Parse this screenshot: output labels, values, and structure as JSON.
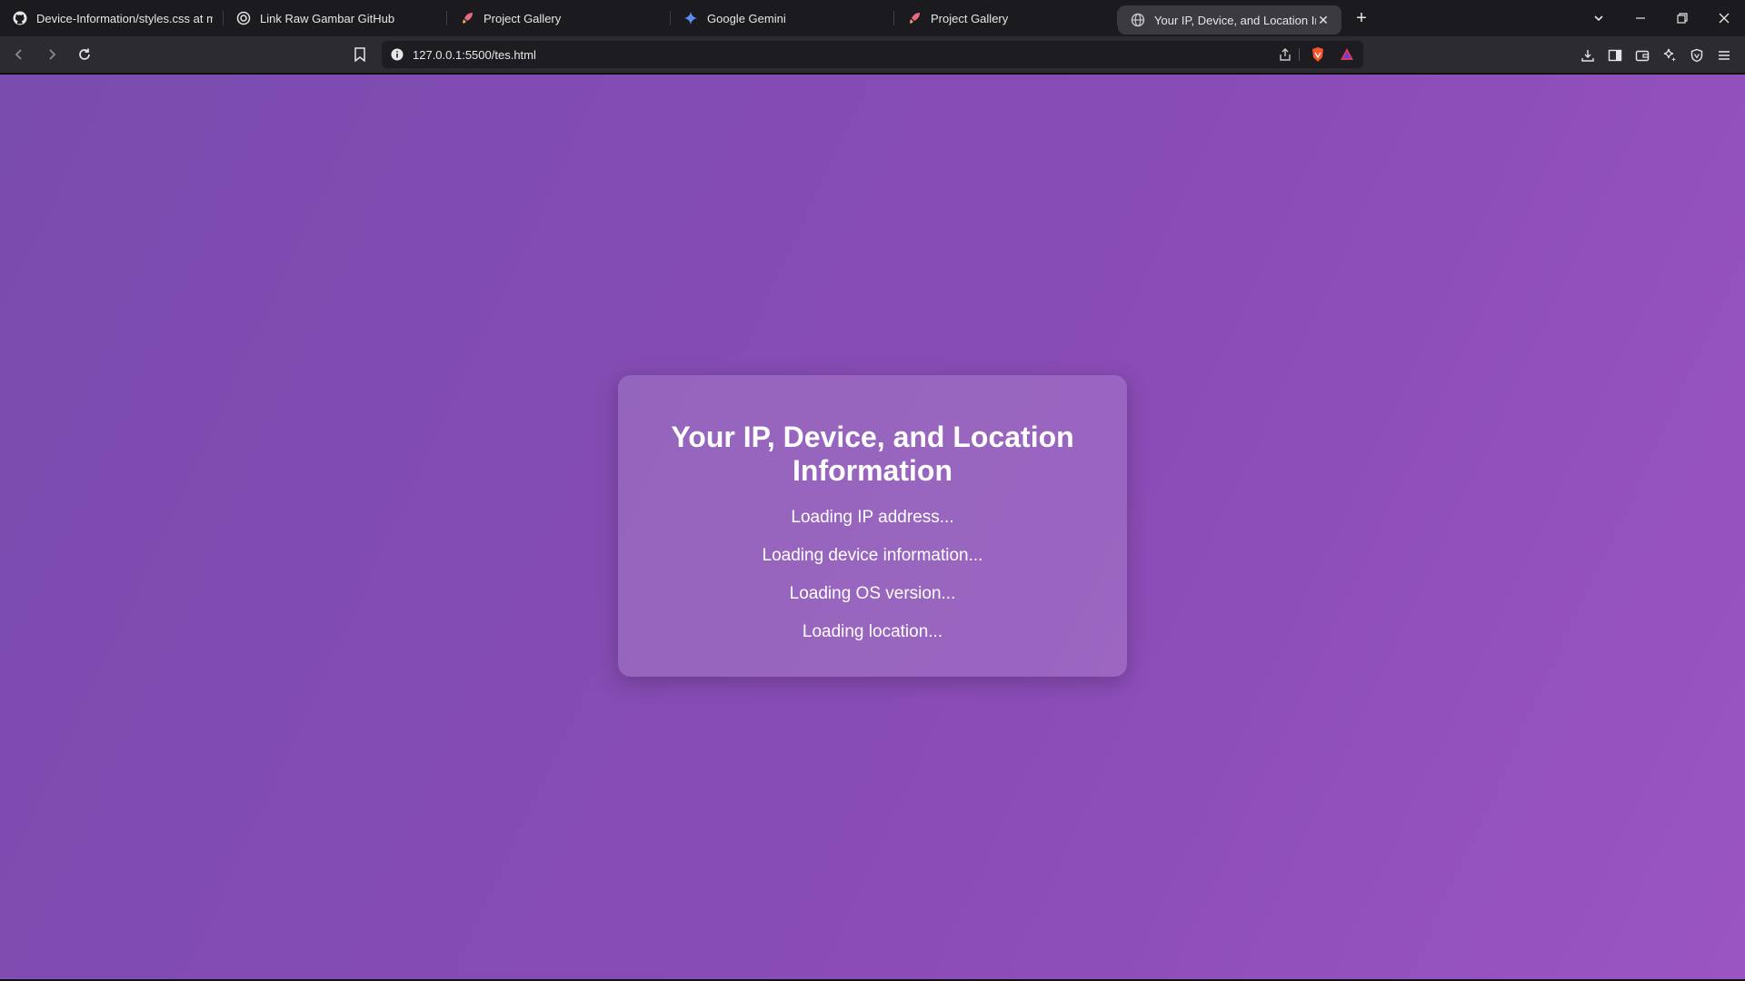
{
  "tabs": [
    {
      "label": "Device-Information/styles.css at main",
      "icon": "github-icon"
    },
    {
      "label": "Link Raw Gambar GitHub",
      "icon": "openai-icon"
    },
    {
      "label": "Project Gallery",
      "icon": "rocket-icon"
    },
    {
      "label": "Google Gemini",
      "icon": "gemini-icon"
    },
    {
      "label": "Project Gallery",
      "icon": "rocket-icon"
    },
    {
      "label": "Your IP, Device, and Location Information",
      "icon": "globe-icon",
      "active": true
    }
  ],
  "address_bar": {
    "url": "127.0.0.1:5500/tes.html"
  },
  "page": {
    "title": "Your IP, Device, and Location Information",
    "ip": "Loading IP address...",
    "device": "Loading device information...",
    "os": "Loading OS version...",
    "location": "Loading location..."
  },
  "colors": {
    "background_start": "#7a4cae",
    "background_end": "#9a55c2",
    "card": "#9463bf",
    "browser_chrome": "#2b2b31"
  }
}
